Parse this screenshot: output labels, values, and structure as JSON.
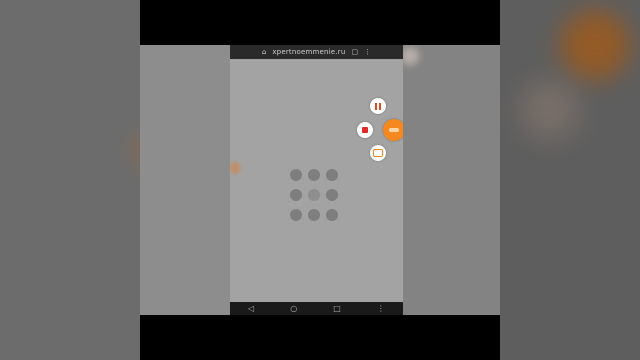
{
  "browser": {
    "url": "xpertnoemmenie.ru",
    "home_icon": "home-icon",
    "tabs_icon": "tabs-icon",
    "menu_icon": "more-vertical-icon"
  },
  "recorder": {
    "pause_icon": "pause-icon",
    "stop_icon": "stop-icon",
    "tools_icon": "toolbox-icon",
    "main_icon": "recorder-icon",
    "accent_color": "#f5881f"
  },
  "screen": {
    "loading_icon": "loading-dots-icon"
  },
  "nav_bar": {
    "back": "◁",
    "home": "○",
    "recents": "□",
    "extra": "⋮"
  }
}
